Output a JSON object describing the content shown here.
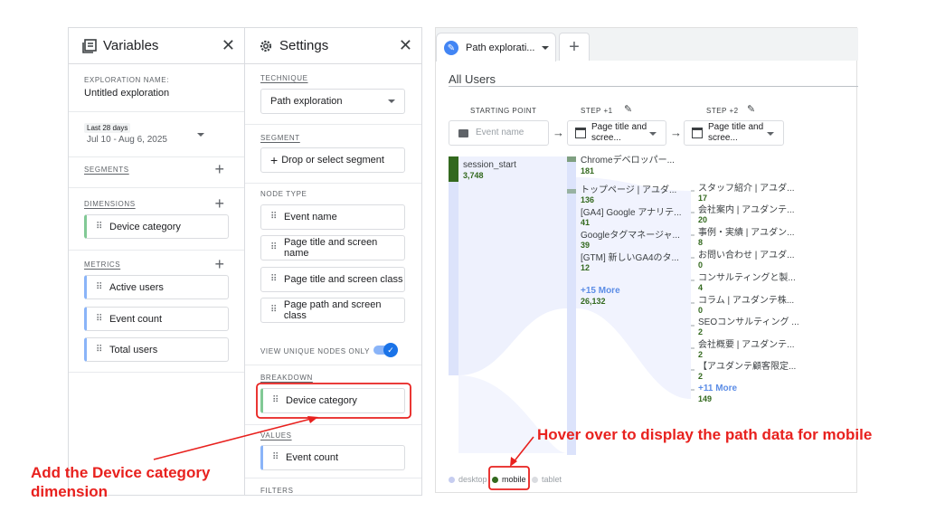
{
  "variables": {
    "title": "Variables",
    "exploration_name_label": "EXPLORATION NAME:",
    "exploration_name": "Untitled exploration",
    "date_label": "Last 28 days",
    "date_range": "Jul 10 - Aug 6, 2025",
    "segments_label": "SEGMENTS",
    "dimensions_label": "DIMENSIONS",
    "dimensions": [
      "Device category"
    ],
    "metrics_label": "METRICS",
    "metrics": [
      "Active users",
      "Event count",
      "Total users"
    ]
  },
  "settings": {
    "title": "Settings",
    "technique_label": "TECHNIQUE",
    "technique": "Path exploration",
    "segment_label": "SEGMENT",
    "segment_placeholder": "Drop or select segment",
    "node_type_label": "NODE TYPE",
    "node_types": [
      "Event name",
      "Page title and screen name",
      "Page title and screen class",
      "Page path and screen class"
    ],
    "view_unique_label": "VIEW UNIQUE NODES ONLY",
    "breakdown_label": "BREAKDOWN",
    "breakdown": "Device category",
    "values_label": "VALUES",
    "values": "Event count",
    "filters_label": "FILTERS"
  },
  "tabs": {
    "active": "Path explorati...",
    "add": "+"
  },
  "explore": {
    "segment_title": "All Users",
    "starting_point_hdr": "STARTING POINT",
    "step1_hdr": "STEP +1",
    "step2_hdr": "STEP +2",
    "start_placeholder": "Event name",
    "step1_select": "Page title and scree...",
    "step2_select": "Page title and scree...",
    "start_node": {
      "label": "session_start",
      "value": "3,748"
    },
    "step1_nodes": [
      {
        "label": "Chromeデベロッパー...",
        "value": "181"
      },
      {
        "label": "トップページ | アユダ...",
        "value": "136"
      },
      {
        "label": "[GA4] Google アナリテ...",
        "value": "41"
      },
      {
        "label": "Googleタグマネージャ...",
        "value": "39"
      },
      {
        "label": "[GTM] 新しいGA4のタ...",
        "value": "12"
      }
    ],
    "step1_more": {
      "label": "+15 More",
      "value": "26,132"
    },
    "step2_nodes": [
      {
        "label": "スタッフ紹介 | アユダ...",
        "value": "17"
      },
      {
        "label": "会社案内 | アユダンテ...",
        "value": "20"
      },
      {
        "label": "事例・実績 | アユダン...",
        "value": "8"
      },
      {
        "label": "お問い合わせ | アユダ...",
        "value": "0"
      },
      {
        "label": "コンサルティングと製...",
        "value": "4"
      },
      {
        "label": "コラム | アユダンテ株...",
        "value": "0"
      },
      {
        "label": "SEOコンサルティング ...",
        "value": "2"
      },
      {
        "label": "会社概要 | アユダンテ...",
        "value": "2"
      },
      {
        "label": "【アユダンテ顧客限定...",
        "value": "2"
      }
    ],
    "step2_more": {
      "label": "+11 More",
      "value": "149"
    },
    "legend": [
      "desktop",
      "mobile",
      "tablet"
    ]
  },
  "annotations": {
    "hover_note": "Hover over to display the path data for mobile",
    "add_note_line1": "Add the Device category",
    "add_note_line2": "dimension"
  },
  "colors": {
    "accent": "#1a73e8",
    "annotation": "#e8211e",
    "mobile": "#33691e",
    "flow": "#dce3fb"
  }
}
